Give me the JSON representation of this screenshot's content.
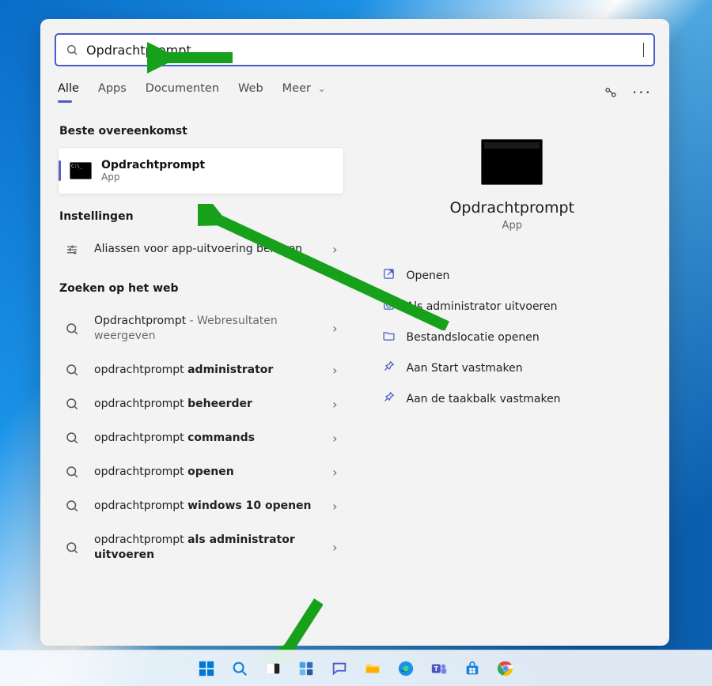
{
  "search": {
    "value": "Opdrachtprompt"
  },
  "tabs": {
    "items": [
      "Alle",
      "Apps",
      "Documenten",
      "Web",
      "Meer"
    ],
    "active": 0
  },
  "left": {
    "best_label": "Beste overeenkomst",
    "best": {
      "title": "Opdrachtprompt",
      "subtitle": "App"
    },
    "settings_label": "Instellingen",
    "settings_items": [
      {
        "title": "Aliassen voor app-uitvoering beheren"
      }
    ],
    "web_label": "Zoeken op het web",
    "web_items": [
      {
        "prefix": "Opdrachtprompt",
        "suffix": " - Webresultaten weergeven",
        "dim_suffix": true
      },
      {
        "prefix": "opdrachtprompt ",
        "bold": "administrator"
      },
      {
        "prefix": "opdrachtprompt ",
        "bold": "beheerder"
      },
      {
        "prefix": "opdrachtprompt ",
        "bold": "commands"
      },
      {
        "prefix": "opdrachtprompt ",
        "bold": "openen"
      },
      {
        "prefix": "opdrachtprompt ",
        "bold": "windows 10 openen"
      },
      {
        "prefix": "opdrachtprompt ",
        "bold": "als administrator uitvoeren"
      }
    ]
  },
  "right": {
    "title": "Opdrachtprompt",
    "subtitle": "App",
    "actions": [
      {
        "icon": "open",
        "label": "Openen"
      },
      {
        "icon": "shield",
        "label": "Als administrator uitvoeren"
      },
      {
        "icon": "folder",
        "label": "Bestandslocatie openen"
      },
      {
        "icon": "pin",
        "label": "Aan Start vastmaken"
      },
      {
        "icon": "pin",
        "label": "Aan de taakbalk vastmaken"
      }
    ]
  },
  "taskbar": [
    "start",
    "search",
    "taskview",
    "widgets",
    "chat",
    "explorer",
    "edge",
    "teams",
    "store",
    "chrome"
  ]
}
